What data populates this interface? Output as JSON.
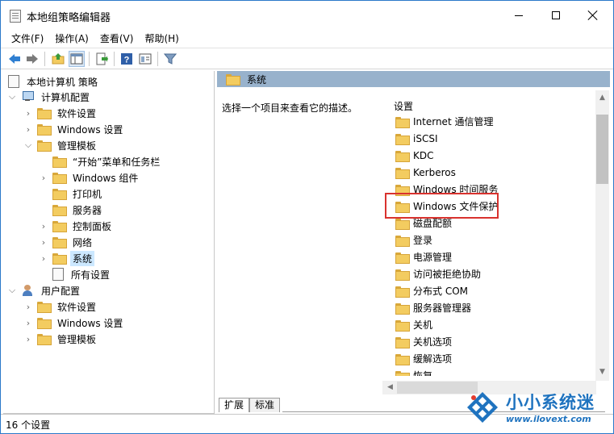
{
  "window": {
    "title": "本地组策略编辑器"
  },
  "menu": [
    "文件(F)",
    "操作(A)",
    "查看(V)",
    "帮助(H)"
  ],
  "toolbar": {
    "icons": [
      "back-arrow-icon",
      "forward-arrow-icon",
      "up-folder-icon",
      "show-hide-tree-icon",
      "export-list-icon",
      "help-icon",
      "properties-pane-icon",
      "filter-icon"
    ]
  },
  "tree": {
    "root": "本地计算机 策略",
    "computer_config": "计算机配置",
    "cc_software": "软件设置",
    "cc_windows": "Windows 设置",
    "cc_admin": "管理模板",
    "start_menu": "“开始”菜单和任务栏",
    "windows_components": "Windows 组件",
    "printers": "打印机",
    "server": "服务器",
    "control_panel": "控制面板",
    "network": "网络",
    "system": "系统",
    "all_settings": "所有设置",
    "user_config": "用户配置",
    "uc_software": "软件设置",
    "uc_windows": "Windows 设置",
    "uc_admin": "管理模板"
  },
  "right": {
    "header": "系统",
    "description": "选择一个项目来查看它的描述。",
    "column_header": "设置",
    "items": [
      "Internet 通信管理",
      "iSCSI",
      "KDC",
      "Kerberos",
      "Windows 时间服务",
      "Windows 文件保护",
      "磁盘配额",
      "登录",
      "电源管理",
      "访问被拒绝协助",
      "分布式 COM",
      "服务器管理器",
      "关机",
      "关机选项",
      "缓解选项",
      "恢复"
    ]
  },
  "tabs": {
    "extended": "扩展",
    "standard": "标准"
  },
  "status": {
    "text": "16 个设置"
  },
  "watermark": {
    "cn": "小小系统迷",
    "url": "www.ilovext.com"
  },
  "colors": {
    "header_bar": "#98b2cc",
    "highlight_box": "#d9322e",
    "selection": "#cce8ff",
    "watermark": "#1f73bf"
  }
}
